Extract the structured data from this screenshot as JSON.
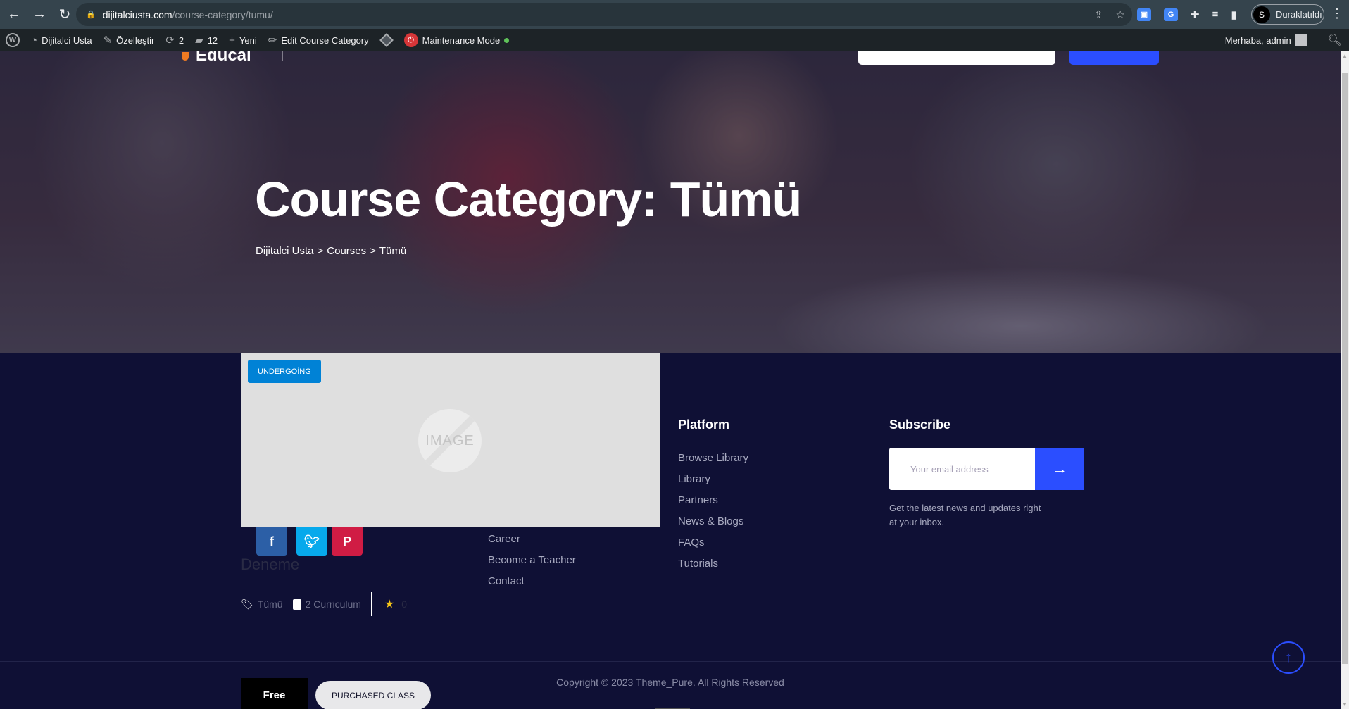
{
  "browser": {
    "url_host": "dijitalciusta.com",
    "url_path": "/course-category/tumu/",
    "profile_label": "Duraklatıldı",
    "profile_initial": "S"
  },
  "admin_bar": {
    "site_name": "Dijitalci Usta",
    "customize": "Özelleştir",
    "updates_count": "2",
    "comments_count": "12",
    "new_label": "Yeni",
    "edit_label": "Edit Course Category",
    "maintenance_label": "Maintenance Mode",
    "greeting": "Merhaba, admin"
  },
  "hero": {
    "title": "Course Category: Tümü",
    "breadcrumb": [
      "Dijitalci Usta",
      ">",
      "Courses",
      ">",
      "Tümü"
    ]
  },
  "course": {
    "badge": "UNDERGOİNG",
    "placeholder_text": "IMAGE",
    "title": "Deneme",
    "category": "Tümü",
    "curriculum": "2 Curriculum",
    "rating": "0",
    "price": "Free",
    "action": "PURCHASED CLASS",
    "social": [
      "f",
      "t",
      "p"
    ]
  },
  "footer": {
    "company_links": [
      "Career",
      "Become a Teacher",
      "Contact"
    ],
    "platform": {
      "heading": "Platform",
      "links": [
        "Browse Library",
        "Library",
        "Partners",
        "News & Blogs",
        "FAQs",
        "Tutorials"
      ]
    },
    "subscribe": {
      "heading": "Subscribe",
      "placeholder": "Your email address",
      "note": "Get the latest news and updates right at your inbox."
    },
    "copyright": "Copyright © 2023 Theme_Pure. All Rights Reserved"
  },
  "colors": {
    "accent_blue": "#2b4eff",
    "badge_blue": "#0082d6",
    "footer_bg": "#0f1035",
    "facebook": "#2c5fa6",
    "twitter": "#07a9ec",
    "pinterest": "#d01c44"
  }
}
